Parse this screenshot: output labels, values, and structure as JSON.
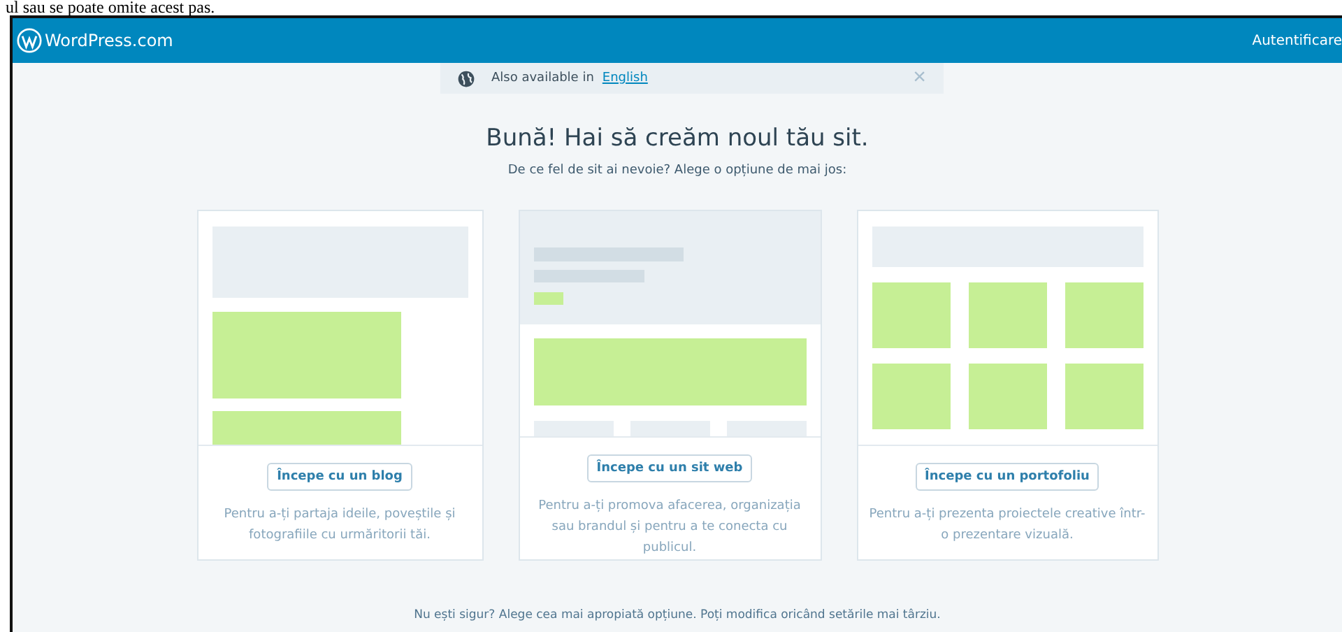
{
  "document_text": "ul sau se poate omite acest pas.",
  "top_bar": {
    "logo": "WordPress.com",
    "login": "Autentificare"
  },
  "notice": {
    "text": "Also available in",
    "link": "English",
    "close": "×"
  },
  "heading": "Bună! Hai să creăm noul tău sit.",
  "subheading": "De ce fel de sit ai nevoie? Alege o opțiune de mai jos:",
  "cards": [
    {
      "kind": "blog",
      "button": "Începe cu un blog",
      "description": "Pentru a-ți partaja ideile, poveștile și fotografiile cu urmăritorii tăi."
    },
    {
      "kind": "website",
      "button": "Începe cu un sit web",
      "description": "Pentru a-ți promova afacerea, organizația sau brandul și pentru a te conecta cu publicul."
    },
    {
      "kind": "portfolio",
      "button": "Începe cu un portofoliu",
      "description": "Pentru a-ți prezenta proiectele creative într-o prezentare vizuală."
    }
  ],
  "footer_text": "Nu ești sigur? Alege cea mai apropiată opțiune. Poți modifica oricând setările mai târziu."
}
